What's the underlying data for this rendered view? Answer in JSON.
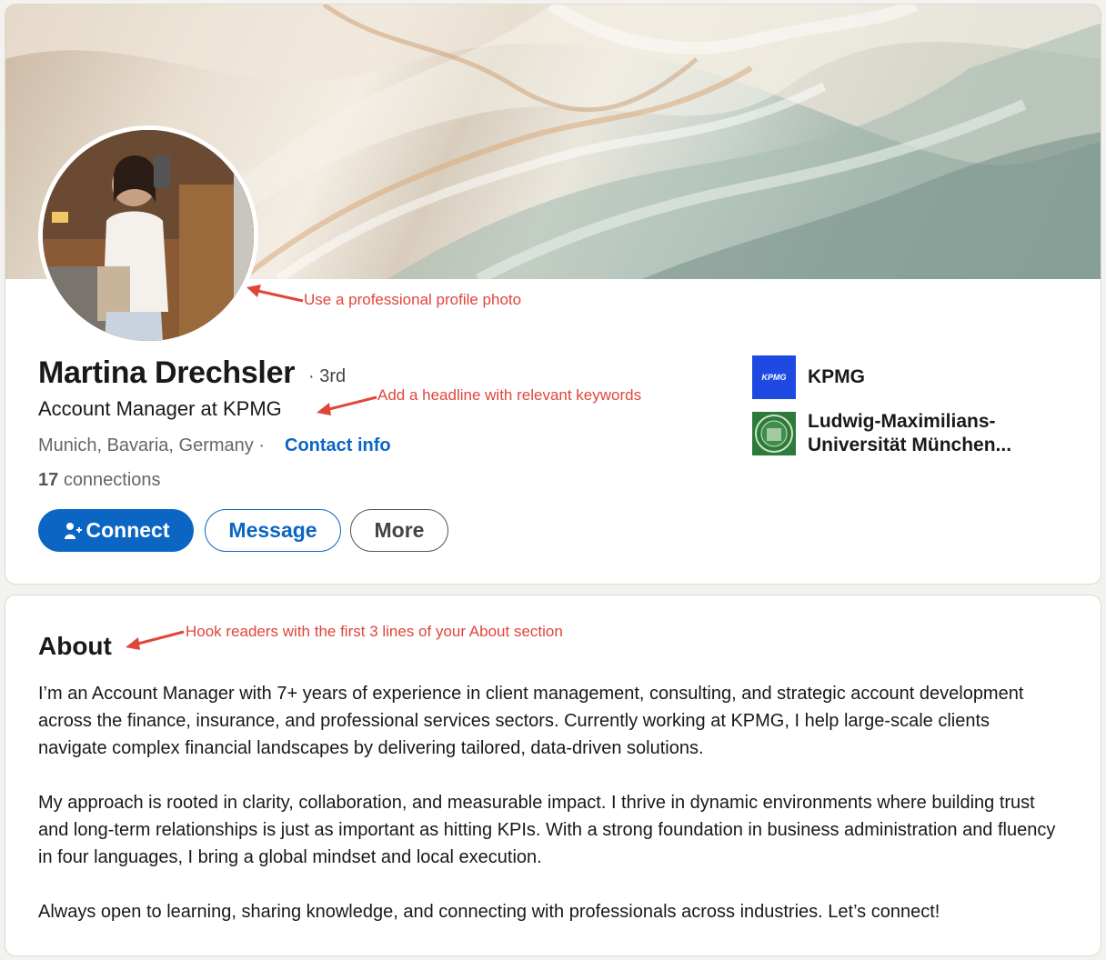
{
  "profile": {
    "name": "Martina Drechsler",
    "degree": "· 3rd",
    "headline": "Account Manager at KPMG",
    "location": "Munich, Bavaria, Germany ·",
    "contact_info": "Contact info",
    "connections_count": "17",
    "connections_label": "connections"
  },
  "actions": {
    "connect": "Connect",
    "message": "Message",
    "more": "More"
  },
  "organizations": [
    {
      "name": "KPMG",
      "logo_text": "KPMG",
      "logo_color": "#1e49e2"
    },
    {
      "name": "Ludwig-Maximilians-Universität München...",
      "logo_color": "#2d7a3a"
    }
  ],
  "annotations": {
    "photo": "Use a professional profile photo",
    "headline": "Add a headline with relevant keywords",
    "about": "Hook readers with the first 3 lines of your About section"
  },
  "about": {
    "title": "About",
    "paragraphs": [
      "I’m an Account Manager with 7+ years of experience in client management, consulting, and strategic account development across the finance, insurance, and professional services sectors. Currently working at KPMG, I help large-scale clients navigate complex financial landscapes by delivering tailored, data-driven solutions.",
      "My approach is rooted in clarity, collaboration, and measurable impact. I thrive in dynamic environments where building trust and long-term relationships is just as important as hitting KPIs. With a strong foundation in business administration and fluency in four languages, I bring a global mindset and local execution.",
      "Always open to learning, sharing knowledge, and connecting with professionals across industries. Let’s connect!"
    ]
  },
  "colors": {
    "accent": "#0a66c2",
    "annotation": "#e0453a"
  }
}
